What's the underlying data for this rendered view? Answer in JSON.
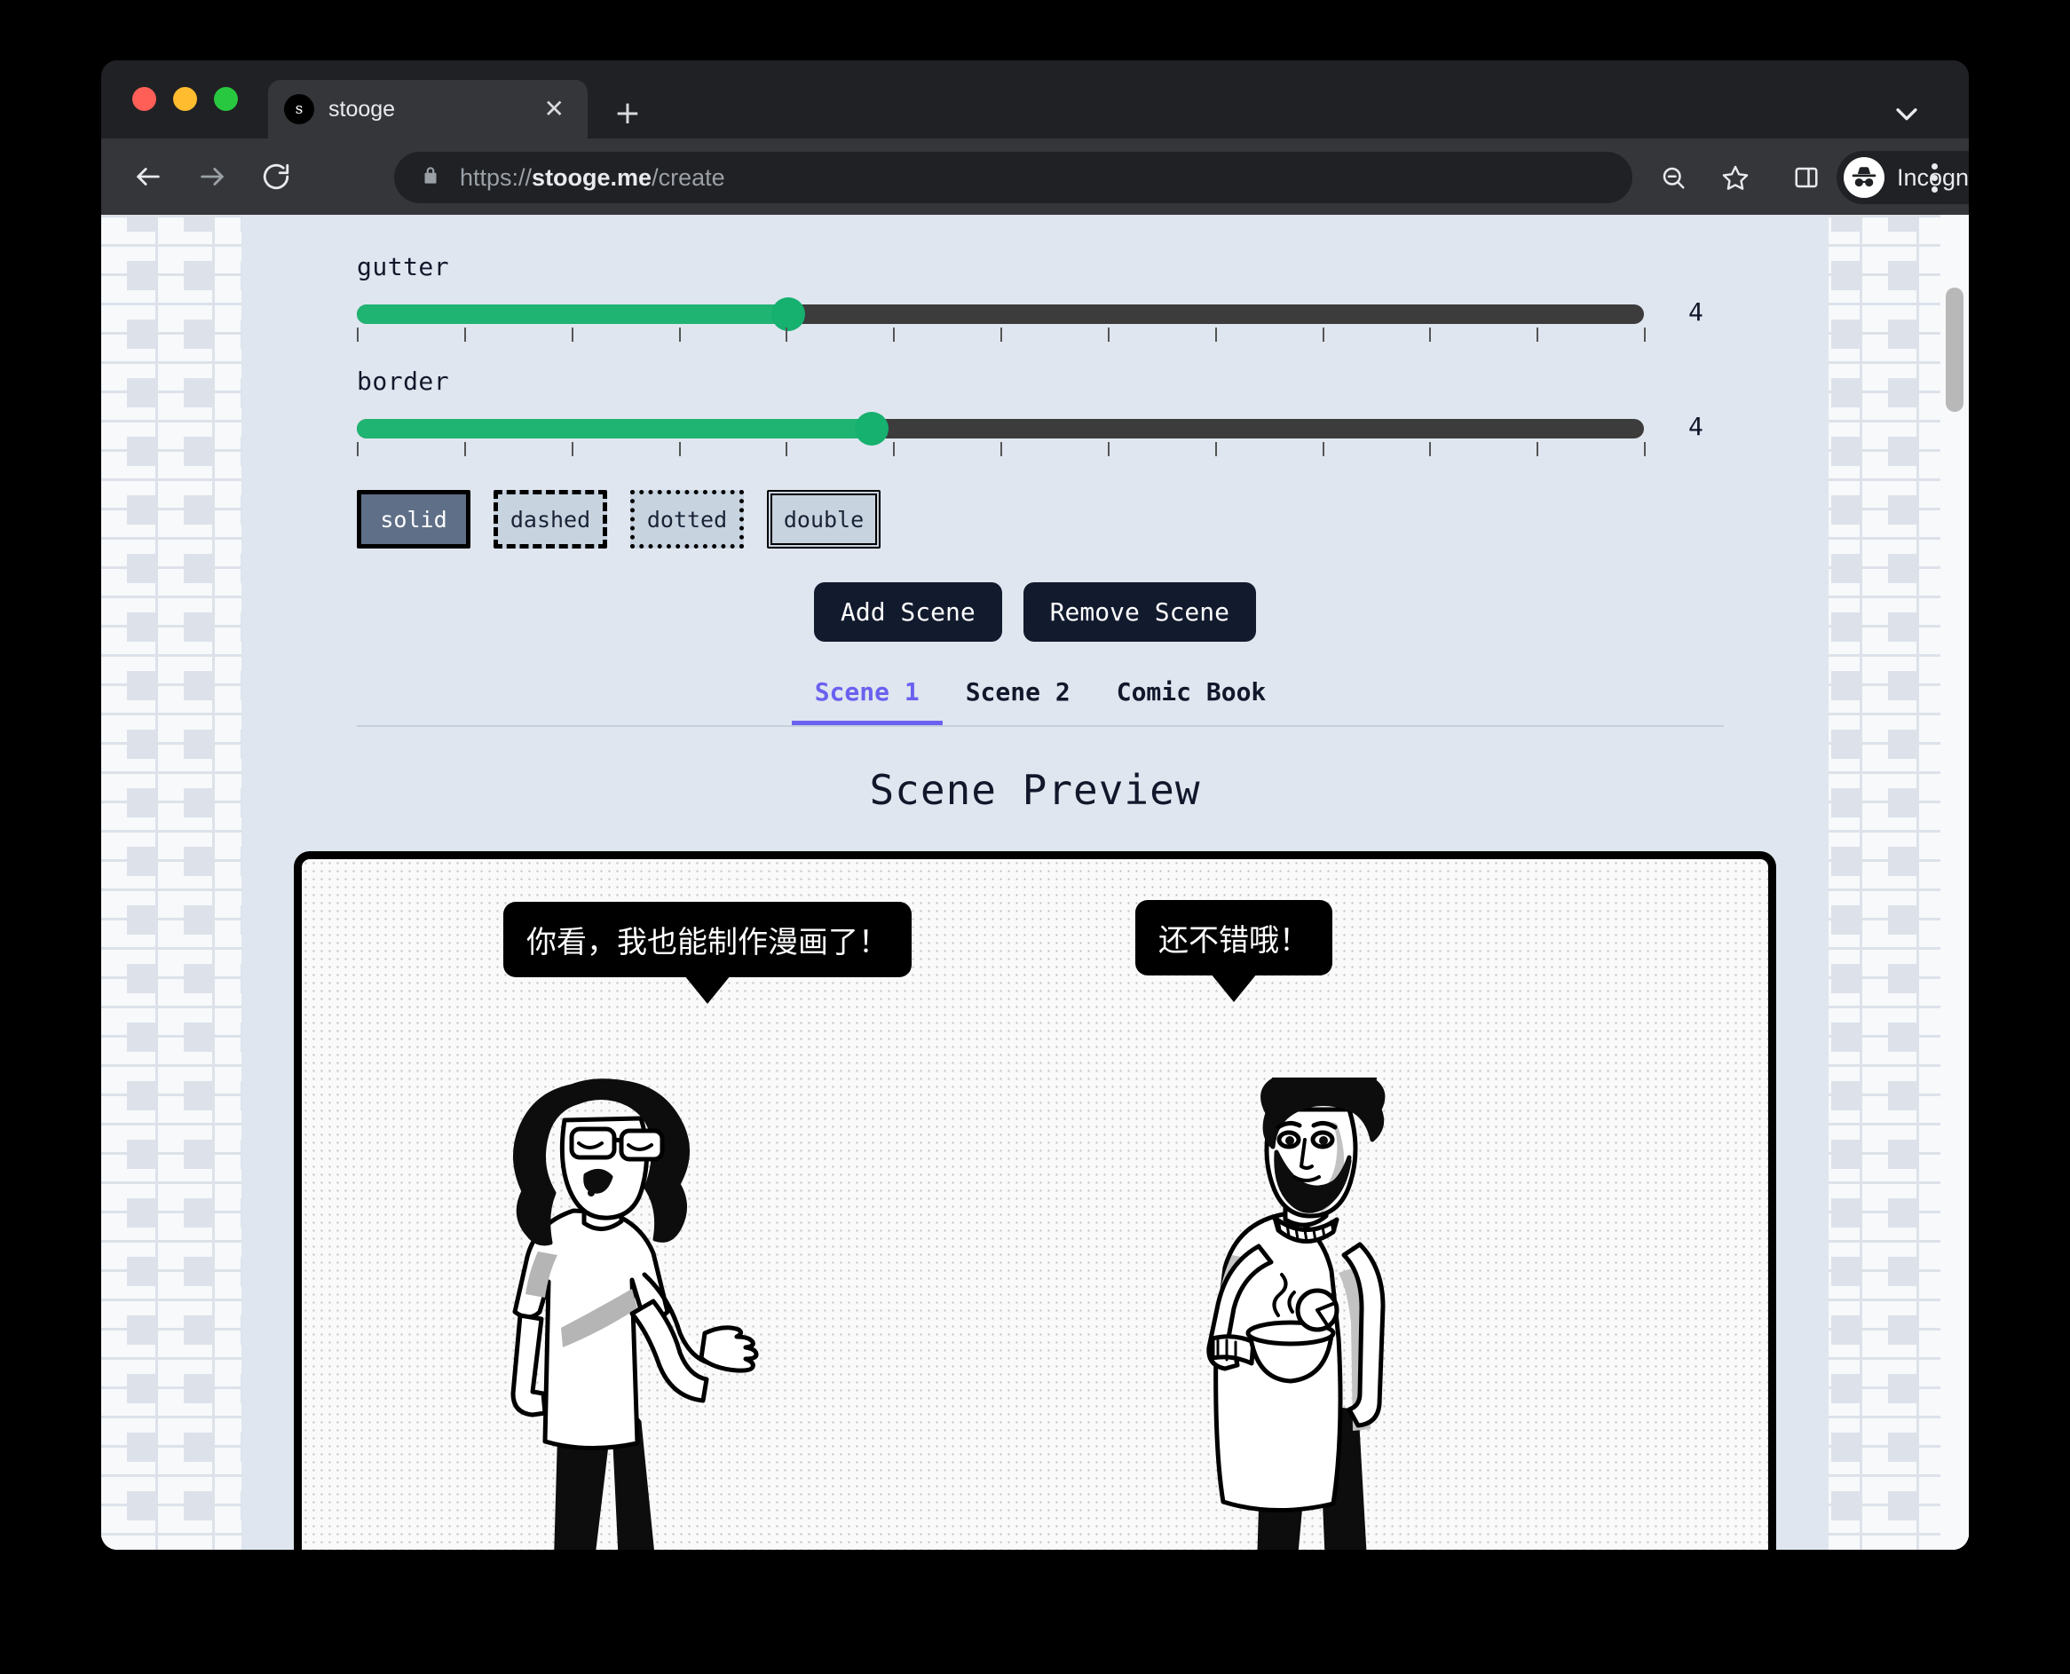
{
  "browser": {
    "tab": {
      "title": "stooge",
      "favicon_letter": "s",
      "close_label": "✕"
    },
    "new_tab_label": "+",
    "url": {
      "scheme": "https://",
      "host": "stooge.me",
      "path": "/create"
    },
    "profile_label": "Incognito",
    "icons": {
      "back": "back-arrow-icon",
      "forward": "forward-arrow-icon",
      "reload": "reload-icon",
      "lock": "lock-icon",
      "zoom_out": "zoom-out-icon",
      "bookmark": "star-icon",
      "side_panel": "side-panel-icon",
      "incognito": "incognito-hat-icon",
      "menu": "three-dot-menu-icon",
      "window_chevron": "chevron-down-icon"
    }
  },
  "controls": {
    "gutter": {
      "label": "gutter",
      "value": "4",
      "percent": 33.5,
      "ticks": 13
    },
    "border": {
      "label": "border",
      "value": "4",
      "percent": 40.0,
      "ticks": 13
    },
    "border_styles": [
      {
        "label": "solid",
        "style": "solid",
        "selected": true
      },
      {
        "label": "dashed",
        "style": "dashed",
        "selected": false
      },
      {
        "label": "dotted",
        "style": "dotted",
        "selected": false
      },
      {
        "label": "double",
        "style": "double",
        "selected": false
      }
    ]
  },
  "scene_actions": {
    "add_label": "Add Scene",
    "remove_label": "Remove Scene"
  },
  "tabs": [
    {
      "label": "Scene 1",
      "active": true
    },
    {
      "label": "Scene 2",
      "active": false
    },
    {
      "label": "Comic Book",
      "active": false
    }
  ],
  "preview": {
    "heading": "Scene Preview",
    "cells": [
      {
        "bubble": "你看，我也能制作漫画了！",
        "character": "curly-haired-woman-with-glasses-gesturing"
      },
      {
        "bubble": "还不错哦！",
        "character": "bearded-man-holding-bowl"
      }
    ]
  },
  "colors": {
    "accent_green": "#16b06f",
    "tab_active": "#6a61f0",
    "page_bg": "#dfe6ef",
    "dark_button": "#121a2e",
    "slider_track": "#3c3c3c",
    "selected_style_btn": "#5f6f88"
  }
}
